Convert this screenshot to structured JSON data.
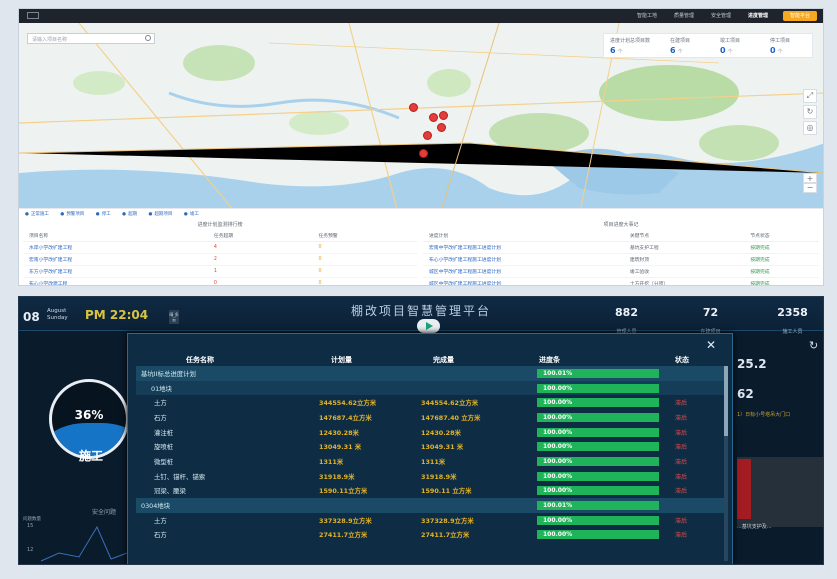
{
  "top_nav": {
    "items": [
      "智能工地",
      "质量管理",
      "安全管理",
      "进度管理"
    ],
    "active": "进度管理",
    "action_button": "智能平台"
  },
  "map": {
    "search_placeholder": "请输入项目名称",
    "stats": [
      {
        "label": "进度计划总项目数",
        "value": "6",
        "unit": "个"
      },
      {
        "label": "在建项目",
        "value": "6",
        "unit": "个"
      },
      {
        "label": "竣工项目",
        "value": "0",
        "unit": "个"
      },
      {
        "label": "停工项目",
        "value": "0",
        "unit": "个"
      }
    ],
    "legend": [
      "正常施工",
      "预警项目",
      "停工",
      "超期",
      "超期项目",
      "竣工"
    ]
  },
  "delay_table": {
    "title": "进度计划监测排行榜",
    "headers": [
      "项目名称",
      "任务超期",
      "任务预警"
    ],
    "rows": [
      {
        "name": "水岸小学改扩建工程",
        "overdue": "4",
        "warn": "0"
      },
      {
        "name": "宏南小学改扩建工程",
        "overdue": "2",
        "warn": "0"
      },
      {
        "name": "东方小学改扩建工程",
        "overdue": "1",
        "warn": "0"
      },
      {
        "name": "布心小学改建工程",
        "overdue": "0",
        "warn": "0"
      }
    ]
  },
  "node_table": {
    "title": "项目进度大事记",
    "headers": [
      "进度计划",
      "关键节点",
      "节点状态"
    ],
    "rows": [
      {
        "plan": "宏南中学改扩建工程施工进度计划",
        "node": "基坑支护工程",
        "status": "按期完成"
      },
      {
        "plan": "布心小学改扩建工程施工进度计划",
        "node": "建筑封顶",
        "status": "按期完成"
      },
      {
        "plan": "城区中学改扩建工程施工进度计划",
        "node": "竣工验收",
        "status": "按期完成"
      },
      {
        "plan": "城区中学改扩建工程施工进度计划",
        "node": "土方开挖（分项）",
        "status": "按期完成"
      }
    ]
  },
  "screen": {
    "title": "棚改项目智慧管理平台",
    "day": "08",
    "month": "August",
    "weekday": "Sunday",
    "time": "PM 22:04",
    "weather_mini": "晴 多云",
    "header_stats": [
      {
        "value": "882",
        "label": "管理人员"
      },
      {
        "value": "72",
        "label": "在建项目"
      },
      {
        "value": "2358",
        "label": "施工人员"
      }
    ],
    "gauge_percent": "36%",
    "gauge_fill": 0.36,
    "gauge_label": "施工",
    "left_section_title": "安全问题",
    "left_chart_caption": "问题数量",
    "left_chart_ticks": [
      "15",
      "12"
    ],
    "right_value_1": "25.2",
    "right_value_2": "62",
    "right_note": "1）日标小号塔吊大门口",
    "right_caption": "...基坑支护及..."
  },
  "modal": {
    "headers": [
      "任务名称",
      "计划量",
      "完成量",
      "进度条",
      "状态"
    ],
    "rows": [
      {
        "type": "grp",
        "name": "基坑II标总进度计划",
        "plan": "",
        "done": "",
        "progress": "100.01%",
        "status": ""
      },
      {
        "type": "sub",
        "name": "01地块",
        "plan": "",
        "done": "",
        "progress": "100.00%",
        "status": ""
      },
      {
        "type": "item",
        "name": "土方",
        "plan": "344554.62立方米",
        "done": "344554.62立方米",
        "progress": "100.00%",
        "status": "滞后"
      },
      {
        "type": "item",
        "name": "石方",
        "plan": "147687.4立方米",
        "done": "147687.40 立方米",
        "progress": "100.00%",
        "status": "滞后"
      },
      {
        "type": "item",
        "name": "灌注桩",
        "plan": "12430.28米",
        "done": "12430.28米",
        "progress": "100.00%",
        "status": "滞后"
      },
      {
        "type": "item",
        "name": "旋喷桩",
        "plan": "13049.31 米",
        "done": "13049.31 米",
        "progress": "100.00%",
        "status": "滞后"
      },
      {
        "type": "item",
        "name": "微型桩",
        "plan": "1311米",
        "done": "1311米",
        "progress": "100.00%",
        "status": "滞后"
      },
      {
        "type": "item",
        "name": "土钉、锚杆、锚索",
        "plan": "31918.9米",
        "done": "31918.9米",
        "progress": "100.00%",
        "status": "滞后"
      },
      {
        "type": "item",
        "name": "冠梁、腰梁",
        "plan": "1590.11立方米",
        "done": "1590.11 立方米",
        "progress": "100.00%",
        "status": "滞后"
      },
      {
        "type": "grp",
        "name": "0304地块",
        "plan": "",
        "done": "",
        "progress": "100.01%",
        "status": ""
      },
      {
        "type": "item",
        "name": "土方",
        "plan": "337328.9立方米",
        "done": "337328.9立方米",
        "progress": "100.00%",
        "status": "滞后"
      },
      {
        "type": "item",
        "name": "石方",
        "plan": "27411.7立方米",
        "done": "27411.7立方米",
        "progress": "100.00%",
        "status": "滞后"
      }
    ]
  }
}
